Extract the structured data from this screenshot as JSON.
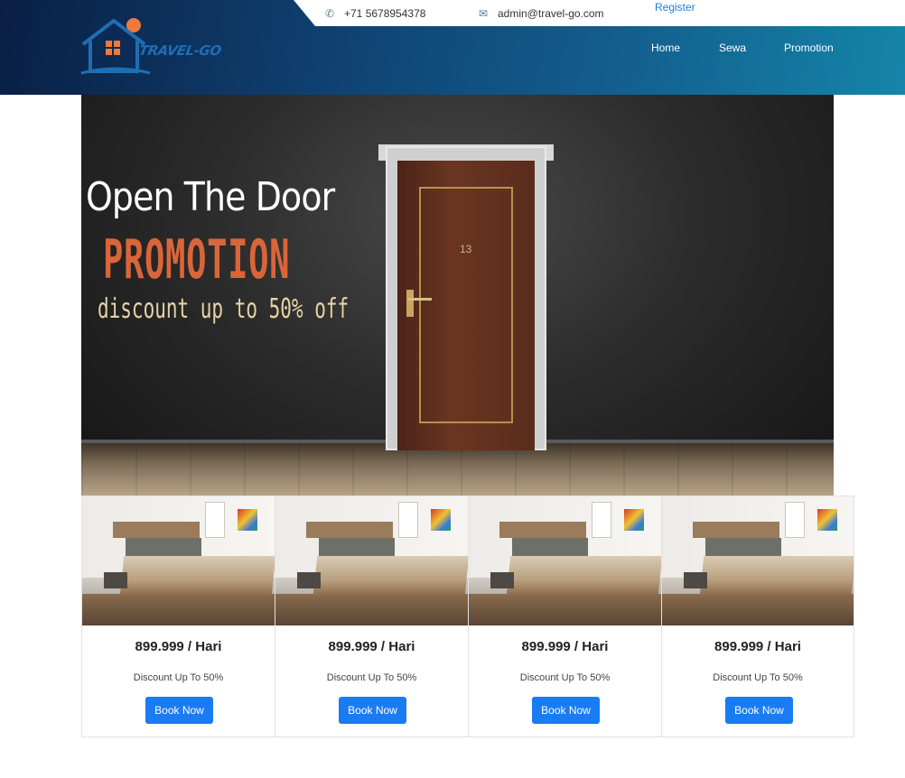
{
  "topbar": {
    "phone": "+71 5678954378",
    "email": "admin@travel-go.com",
    "register_label": "Register"
  },
  "brand": {
    "name": "TRAVEL-GO",
    "colors": {
      "header_dark": "#0a1f45",
      "header_light": "#1585a8",
      "accent": "#1a7cf3",
      "sun": "#f07a3a"
    }
  },
  "nav": {
    "items": [
      {
        "label": "Home"
      },
      {
        "label": "Sewa"
      },
      {
        "label": "Promotion"
      }
    ]
  },
  "hero": {
    "line1": "Open The Door",
    "line2": "PROMOTION",
    "line3": "discount up to 50% off",
    "door_number": "13"
  },
  "cards": [
    {
      "price": "899.999 / Hari",
      "discount": "Discount Up To 50%",
      "button": "Book Now"
    },
    {
      "price": "899.999 / Hari",
      "discount": "Discount Up To 50%",
      "button": "Book Now"
    },
    {
      "price": "899.999 / Hari",
      "discount": "Discount Up To 50%",
      "button": "Book Now"
    },
    {
      "price": "899.999 / Hari",
      "discount": "Discount Up To 50%",
      "button": "Book Now"
    }
  ],
  "icons": {
    "phone": "phone-icon",
    "email": "envelope-icon"
  }
}
